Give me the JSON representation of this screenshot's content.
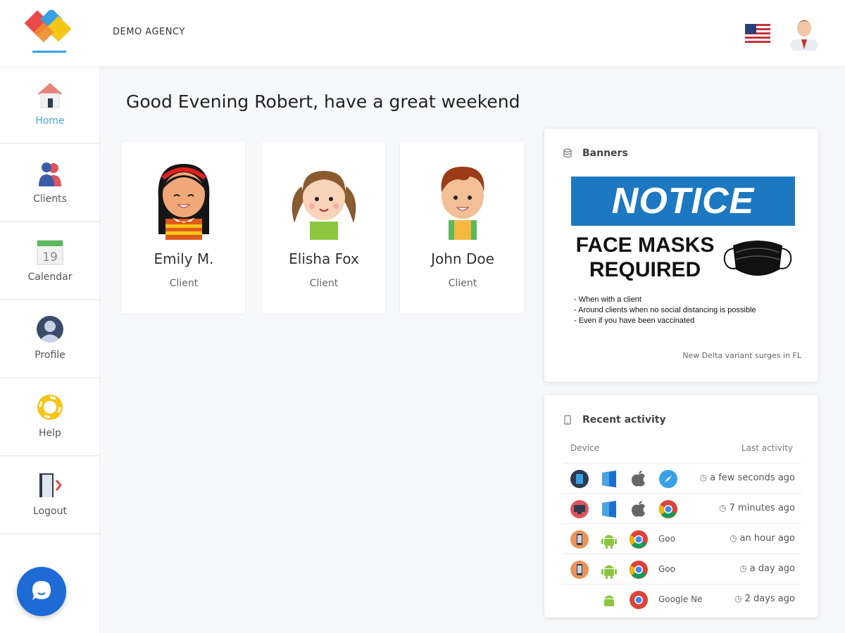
{
  "header": {
    "agency_name": "DEMO AGENCY",
    "logo_icon": "agency-logo",
    "language_icon": "us-flag-icon",
    "avatar_icon": "user-avatar"
  },
  "sidebar": {
    "items": [
      {
        "label": "Home",
        "icon": "home-icon",
        "active": true
      },
      {
        "label": "Clients",
        "icon": "clients-icon",
        "active": false
      },
      {
        "label": "Calendar",
        "icon": "calendar-icon",
        "active": false
      },
      {
        "label": "Profile",
        "icon": "profile-icon",
        "active": false
      },
      {
        "label": "Help",
        "icon": "help-icon",
        "active": false
      },
      {
        "label": "Logout",
        "icon": "logout-icon",
        "active": false
      }
    ],
    "calendar_day": "19",
    "chat_icon": "chat-bubble-icon"
  },
  "main": {
    "greeting": "Good Evening Robert, have a great weekend",
    "clients": [
      {
        "name": "Emily M.",
        "role": "Client",
        "avatar": "girl-black-hair-avatar"
      },
      {
        "name": "Elisha Fox",
        "role": "Client",
        "avatar": "girl-pigtails-avatar"
      },
      {
        "name": "John Doe",
        "role": "Client",
        "avatar": "boy-avatar"
      }
    ]
  },
  "banners": {
    "title": "Banners",
    "notice": "NOTICE",
    "headline_line1": "FACE MASKS",
    "headline_line2": "REQUIRED",
    "bullets": [
      "- When with a client",
      "- Around clients when no social distancing is possible",
      "- Even if you have been vaccinated"
    ],
    "caption": "New Delta variant surges in FL"
  },
  "activity": {
    "title": "Recent activity",
    "col_device": "Device",
    "col_last": "Last activity",
    "rows": [
      {
        "device": "tablet-icon",
        "os": "windows-icon",
        "platform": "apple-icon",
        "browser": "safari-icon",
        "browser_name": "",
        "time": "a few seconds ago"
      },
      {
        "device": "desktop-icon",
        "os": "windows-icon",
        "platform": "apple-icon",
        "browser": "chrome-icon",
        "browser_name": "",
        "time": "7 minutes ago"
      },
      {
        "device": "phone-icon",
        "os": "android-icon",
        "platform": "",
        "browser": "chrome-icon",
        "browser_name": "Goo",
        "time": "an hour ago"
      },
      {
        "device": "phone-icon",
        "os": "android-icon",
        "platform": "",
        "browser": "chrome-icon",
        "browser_name": "Goo",
        "time": "a day ago"
      },
      {
        "device": "",
        "os": "android-icon",
        "platform": "",
        "browser": "chrome-icon",
        "browser_name": "Google Ne",
        "time": "2 days ago"
      }
    ]
  },
  "colors": {
    "accent": "#4aa3df",
    "chat": "#1e6bd6",
    "notice_blue": "#1c78c0"
  }
}
